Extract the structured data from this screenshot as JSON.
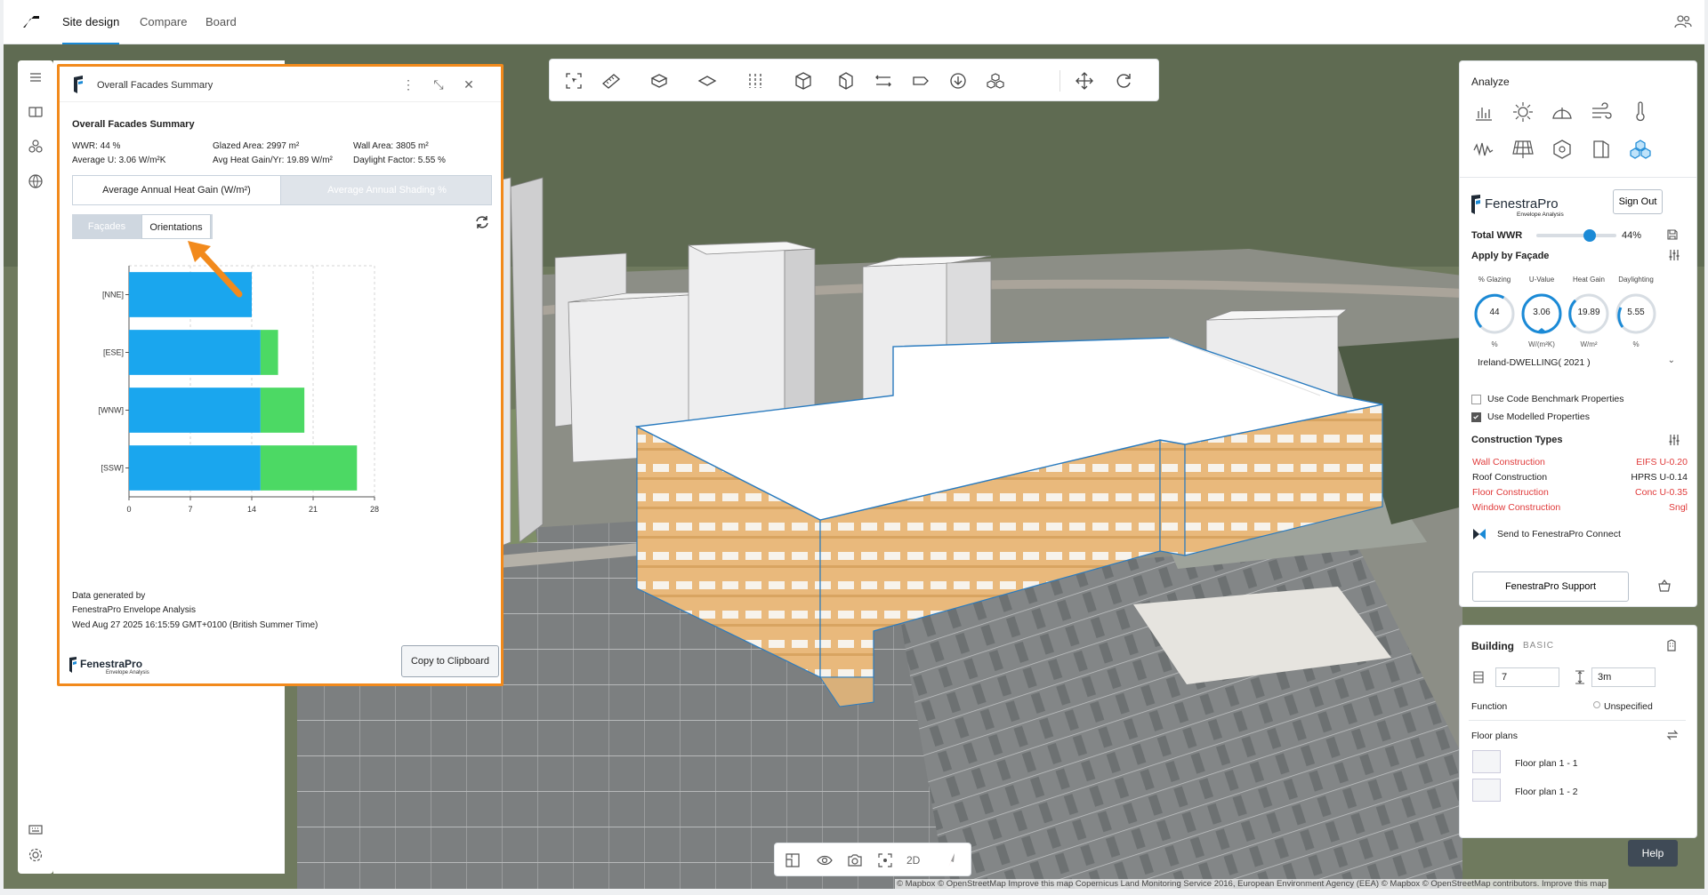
{
  "topbar": {
    "tabs": [
      "Site design",
      "Compare",
      "Board"
    ]
  },
  "toolbar": {
    "tools": [
      "ai-select-icon",
      "ruler-icon",
      "box-icon",
      "plane-icon",
      "column-icon",
      "cube-icon",
      "cube-outline-icon",
      "resize-icon",
      "tag-icon",
      "download-icon",
      "cluster-icon",
      "move-icon",
      "refresh-icon"
    ]
  },
  "facade_window": {
    "title": "Overall Facades Summary",
    "heading": "Overall Facades Summary",
    "stats": {
      "wwr": "WWR: 44 %",
      "glazed_area": "Glazed Area: 2997 m²",
      "wall_area": "Wall Area: 3805 m²",
      "average_u": "Average U: 3.06 W/m²K",
      "avg_heat_gain": "Avg Heat Gain/Yr: 19.89 W/m²",
      "daylight_factor": "Daylight Factor: 5.55 %"
    },
    "tabs": [
      "Average Annual Heat Gain (W/m²)",
      "Average Annual Shading %"
    ],
    "subtabs": [
      "Façades",
      "Orientations"
    ],
    "footer": {
      "line1": "Data generated by",
      "line2": "FenestraPro Envelope Analysis",
      "line3": "Wed Aug 27 2025 16:15:59 GMT+0100 (British Summer Time)"
    },
    "brand": "FenestraPro",
    "brand_sub": "Envelope Analysis",
    "copy_label": "Copy to Clipboard"
  },
  "chart_data": {
    "type": "bar",
    "orientation": "horizontal",
    "stacked": true,
    "categories": [
      "[NNE]",
      "[ESE]",
      "[WNW]",
      "[SSW]"
    ],
    "series": [
      {
        "values": [
          14,
          15,
          15,
          15
        ],
        "color": "#1aa6ee"
      },
      {
        "values": [
          0,
          2,
          5,
          11
        ],
        "color": "#4cd964"
      }
    ],
    "xticks": [
      0,
      7,
      14,
      21,
      28
    ],
    "xlim": [
      0,
      28
    ],
    "grid": true
  },
  "analyze": {
    "title": "Analyze",
    "icons": [
      "bar-chart-icon",
      "sun-icon",
      "shade-icon",
      "wind-icon",
      "thermometer-icon",
      "wave-icon",
      "solar-panel-icon",
      "hexagon-icon",
      "facade-icon",
      "fenestra-icon"
    ],
    "brand": "FenestraPro",
    "brand_sub": "Envelope Analysis",
    "sign_out": "Sign Out",
    "total_wwr_label": "Total WWR",
    "total_wwr_value": "44%",
    "total_wwr_fraction": 0.44,
    "apply_label": "Apply by Façade",
    "gauges": [
      {
        "caption": "% Glazing",
        "value": "44",
        "unit": "%"
      },
      {
        "caption": "U-Value",
        "value": "3.06",
        "unit": "W/(m²K)"
      },
      {
        "caption": "Heat Gain",
        "value": "19.89",
        "unit": "W/m²"
      },
      {
        "caption": "Daylighting",
        "value": "5.55",
        "unit": "%"
      }
    ],
    "benchmark_select": "Ireland-DWELLING( 2021 )",
    "use_code_benchmark": "Use Code Benchmark Properties",
    "use_modelled": "Use Modelled Properties",
    "construction_title": "Construction Types",
    "constructions": [
      {
        "name": "Wall Construction",
        "value": "EIFS U-0.20",
        "alert": true
      },
      {
        "name": "Roof Construction",
        "value": "HPRS U-0.14",
        "alert": false
      },
      {
        "name": "Floor Construction",
        "value": "Conc U-0.35",
        "alert": true
      },
      {
        "name": "Window Construction",
        "value": "Sngl",
        "alert": true
      }
    ],
    "send_label": "Send to FenestraPro Connect",
    "support_label": "FenestraPro Support"
  },
  "building": {
    "title": "Building",
    "badge": "BASIC",
    "floors": "7",
    "height": "3m",
    "function_label": "Function",
    "function_value": "Unspecified",
    "floor_plans_label": "Floor plans",
    "plans": [
      "Floor plan 1 - 1",
      "Floor plan 1 - 2"
    ]
  },
  "bottom": {
    "mode_2d": "2D"
  },
  "help_label": "Help",
  "attribution": "© Mapbox © OpenStreetMap Improve this map Copernicus Land Monitoring Service 2016, European Environment Agency (EEA) © Mapbox © OpenStreetMap contributors. Improve this map"
}
